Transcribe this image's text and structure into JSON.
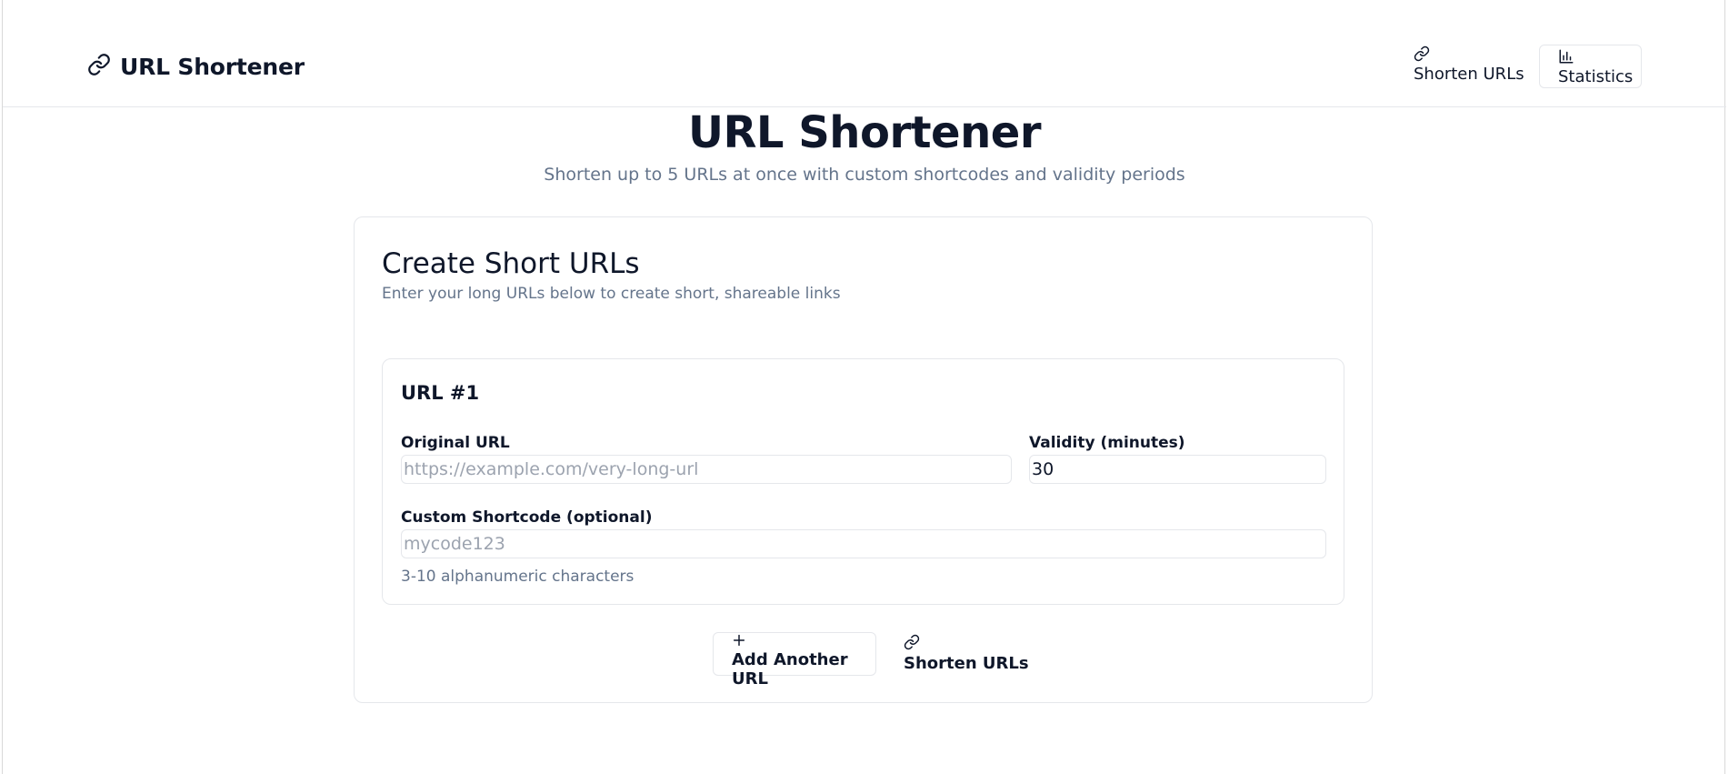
{
  "header": {
    "brand_title": "URL Shortener",
    "brand_icon": "link-icon",
    "nav": {
      "shorten_label": "Shorten URLs",
      "shorten_icon": "link-icon",
      "stats_label": "Statistics",
      "stats_icon": "bar-chart-icon"
    }
  },
  "hero": {
    "title": "URL Shortener",
    "subtitle": "Shorten up to 5 URLs at once with custom shortcodes and validity periods"
  },
  "card": {
    "title": "Create Short URLs",
    "description": "Enter your long URLs below to create short, shareable links",
    "urls": [
      {
        "heading": "URL #1",
        "original_label": "Original URL",
        "original_value": "",
        "original_placeholder": "https://example.com/very-long-url",
        "validity_label": "Validity (minutes)",
        "validity_value": "30",
        "shortcode_label": "Custom Shortcode (optional)",
        "shortcode_value": "",
        "shortcode_placeholder": "mycode123",
        "shortcode_hint": "3-10 alphanumeric characters"
      }
    ],
    "add_button_label": "Add Another URL",
    "add_button_icon": "plus-icon",
    "submit_button_label": "Shorten URLs",
    "submit_button_icon": "link-icon"
  },
  "colors": {
    "text": "#0f172a",
    "muted": "#64748b",
    "border": "#e5e7eb",
    "placeholder": "#9ca3af"
  }
}
